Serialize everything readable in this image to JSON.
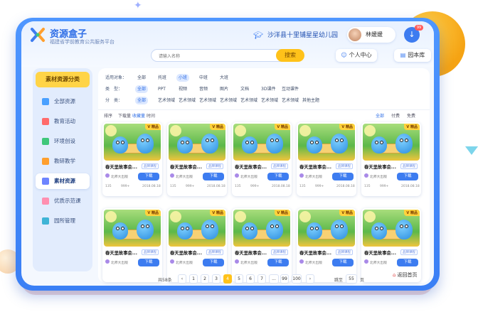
{
  "header": {
    "app_name": "资源盒子",
    "app_sub": "福建省学前教育公共服务平台",
    "school": "沙洋县十里铺星星幼儿园",
    "user_name": "林媛媛",
    "download_badge": "99"
  },
  "search": {
    "placeholder": "请输入名称",
    "button": "搜索"
  },
  "nav_buttons": {
    "center": "个人中心",
    "library": "园本库"
  },
  "sidebar": {
    "title": "素材资源分类",
    "items": [
      {
        "label": "全部资源",
        "color": "#4aa0ff"
      },
      {
        "label": "教育活动",
        "color": "#ff6b6b"
      },
      {
        "label": "环境创设",
        "color": "#3fc77a"
      },
      {
        "label": "教研教学",
        "color": "#ff9f2e"
      },
      {
        "label": "素材资源",
        "color": "#6d84ff"
      },
      {
        "label": "优质示范课",
        "color": "#ff8fb0"
      },
      {
        "label": "园所管理",
        "color": "#3fb4d6"
      }
    ],
    "active_index": 4
  },
  "filters": {
    "target": {
      "label": "适用对象：",
      "options": [
        "全部",
        "托班",
        "小班",
        "中班",
        "大班"
      ],
      "active": 2
    },
    "type": {
      "label": "类　型：",
      "options": [
        "全部",
        "PPT",
        "视频",
        "音频",
        "图片",
        "文档",
        "3D课件",
        "互动课件"
      ],
      "active": 0
    },
    "category": {
      "label": "分　类：",
      "options": [
        "全部",
        "艺术领域",
        "艺术领域",
        "艺术领域",
        "艺术领域",
        "艺术领域",
        "艺术领域",
        "艺术领域",
        "其他主题"
      ],
      "active": 0
    }
  },
  "sort": {
    "left": [
      "排序",
      "下载量",
      "收藏量",
      "时间"
    ],
    "left_active": 2,
    "right": [
      "全部",
      "付费",
      "免费"
    ],
    "right_active": 0
  },
  "cards": [
    {
      "badge": "V 精品",
      "title": "春天里故事会...",
      "tag": "品牌课程",
      "author": "北师大出版",
      "download": "下载",
      "views": "135",
      "likes": "999+",
      "date": "2018.08.18"
    },
    {
      "badge": "V 精品",
      "title": "春天里故事会...",
      "tag": "品牌课程",
      "author": "北师大出版",
      "download": "下载",
      "views": "135",
      "likes": "999+",
      "date": "2018.08.18"
    },
    {
      "badge": "V 精品",
      "title": "春天里故事会...",
      "tag": "品牌课程",
      "author": "北师大出版",
      "download": "下载",
      "views": "135",
      "likes": "999+",
      "date": "2018.08.18"
    },
    {
      "badge": "V 精品",
      "title": "春天里故事会...",
      "tag": "品牌课程",
      "author": "北师大出版",
      "download": "下载",
      "views": "135",
      "likes": "999+",
      "date": "2018.08.18"
    },
    {
      "badge": "V 精品",
      "title": "春天里故事会...",
      "tag": "品牌课程",
      "author": "北师大出版",
      "download": "下载",
      "views": "135",
      "likes": "999+",
      "date": "2018.08.18"
    },
    {
      "badge": "V 精品",
      "title": "春天里故事会...",
      "tag": "品牌课程",
      "author": "北师大出版",
      "download": "下载",
      "views": "",
      "likes": "",
      "date": ""
    },
    {
      "badge": "V 精品",
      "title": "春天里故事会...",
      "tag": "品牌课程",
      "author": "北师大出版",
      "download": "下载",
      "views": "",
      "likes": "",
      "date": ""
    },
    {
      "badge": "V 精品",
      "title": "春天里故事会...",
      "tag": "品牌课程",
      "author": "北师大出版",
      "download": "下载",
      "views": "",
      "likes": "",
      "date": ""
    },
    {
      "badge": "V 精品",
      "title": "春天里故事会...",
      "tag": "品牌课程",
      "author": "北师大出版",
      "download": "下载",
      "views": "",
      "likes": "",
      "date": ""
    },
    {
      "badge": "V 精品",
      "title": "春天里故事会...",
      "tag": "品牌课程",
      "author": "北师大出版",
      "download": "下载",
      "views": "",
      "likes": "",
      "date": ""
    }
  ],
  "pagination": {
    "total": "共58条",
    "prev": "‹",
    "pages": [
      "1",
      "2",
      "3",
      "4",
      "5",
      "6",
      "7",
      "...",
      "99",
      "100"
    ],
    "active_index": 3,
    "next": "›",
    "jump_label": "跳至",
    "jump_value": "55",
    "jump_unit": "页"
  },
  "back_home": "返回首页",
  "icons": {
    "logo": "colorful-x-logo-icon",
    "school": "graduation-cap-icon",
    "download": "download-arrow-icon",
    "center": "user-icon",
    "library": "book-icon",
    "home": "home-icon"
  }
}
